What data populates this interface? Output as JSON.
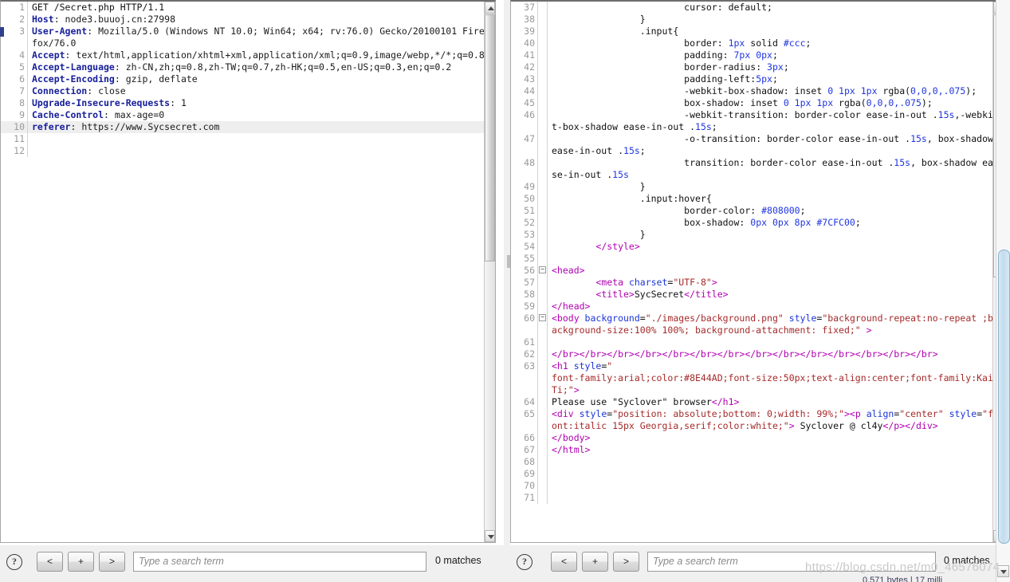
{
  "app": {
    "name": "burp-repeater-message-editor",
    "watermark": "https://blog.csdn.net/m0_46576074",
    "status_line": "0,571 bytes | 17 milli"
  },
  "colors": {
    "header_key": "#18209a",
    "tag": "#b000b0",
    "attribute": "#1c34d6",
    "attribute_value": "#a52a2a",
    "css_value": "#1f35e0",
    "gutter_text": "#999999",
    "highlight_row": "#eeeeee",
    "outer_scroll_thumb": "#c3dcee"
  },
  "left_pane": {
    "name": "request-pane",
    "first_line_number": 1,
    "highlighted_line": 10,
    "lines": [
      {
        "n": 1,
        "segments": [
          {
            "t": "GET /Secret.php HTTP/1.1",
            "c": "txt"
          }
        ]
      },
      {
        "n": 2,
        "segments": [
          {
            "t": "Host",
            "c": "hk"
          },
          {
            "t": ": node3.buuoj.cn:27998",
            "c": "hv"
          }
        ]
      },
      {
        "n": 3,
        "segments": [
          {
            "t": "User-Agent",
            "c": "hk"
          },
          {
            "t": ": Mozilla/5.0 (Windows NT 10.0; Win64; x64; rv:76.0) Gecko/20100101 Firefox/76.0",
            "c": "hv"
          }
        ]
      },
      {
        "n": 4,
        "segments": [
          {
            "t": "Accept",
            "c": "hk"
          },
          {
            "t": ": text/html,application/xhtml+xml,application/xml;q=0.9,image/webp,*/*;q=0.8",
            "c": "hv"
          }
        ]
      },
      {
        "n": 5,
        "segments": [
          {
            "t": "Accept-Language",
            "c": "hk"
          },
          {
            "t": ": zh-CN,zh;q=0.8,zh-TW;q=0.7,zh-HK;q=0.5,en-US;q=0.3,en;q=0.2",
            "c": "hv"
          }
        ]
      },
      {
        "n": 6,
        "segments": [
          {
            "t": "Accept-Encoding",
            "c": "hk"
          },
          {
            "t": ": gzip, deflate",
            "c": "hv"
          }
        ]
      },
      {
        "n": 7,
        "segments": [
          {
            "t": "Connection",
            "c": "hk"
          },
          {
            "t": ": close",
            "c": "hv"
          }
        ]
      },
      {
        "n": 8,
        "segments": [
          {
            "t": "Upgrade-Insecure-Requests",
            "c": "hk"
          },
          {
            "t": ": 1",
            "c": "hv"
          }
        ]
      },
      {
        "n": 9,
        "segments": [
          {
            "t": "Cache-Control",
            "c": "hk"
          },
          {
            "t": ": max-age=0",
            "c": "hv"
          }
        ]
      },
      {
        "n": 10,
        "segments": [
          {
            "t": "referer",
            "c": "hk"
          },
          {
            "t": ": https://www.Sycsecret.com",
            "c": "hv"
          }
        ],
        "hl": true
      },
      {
        "n": 11,
        "segments": []
      },
      {
        "n": 12,
        "segments": []
      }
    ],
    "toolbar": {
      "help_label": "?",
      "prev_label": "<",
      "add_label": "+",
      "next_label": ">",
      "search_placeholder": "Type a search term",
      "search_value": "",
      "matches_label": "0 matches"
    }
  },
  "right_pane": {
    "name": "response-pane",
    "first_line_number": 37,
    "fold_lines": [
      56,
      60
    ],
    "lines": [
      {
        "n": 37,
        "segments": [
          {
            "t": "                        ",
            "c": "txt"
          },
          {
            "t": "cursor",
            "c": "cssp"
          },
          {
            "t": ": ",
            "c": "punct"
          },
          {
            "t": "default",
            "c": "cssp"
          },
          {
            "t": ";",
            "c": "punct"
          }
        ]
      },
      {
        "n": 38,
        "segments": [
          {
            "t": "                }",
            "c": "txt"
          }
        ]
      },
      {
        "n": 39,
        "segments": [
          {
            "t": "                .input{",
            "c": "txt"
          }
        ]
      },
      {
        "n": 40,
        "segments": [
          {
            "t": "                        ",
            "c": "txt"
          },
          {
            "t": "border",
            "c": "cssp"
          },
          {
            "t": ": ",
            "c": "punct"
          },
          {
            "t": "1px",
            "c": "cssv"
          },
          {
            "t": " solid ",
            "c": "cssp"
          },
          {
            "t": "#ccc",
            "c": "cssv"
          },
          {
            "t": ";",
            "c": "punct"
          }
        ]
      },
      {
        "n": 41,
        "segments": [
          {
            "t": "                        ",
            "c": "txt"
          },
          {
            "t": "padding",
            "c": "cssp"
          },
          {
            "t": ": ",
            "c": "punct"
          },
          {
            "t": "7px 0px",
            "c": "cssv"
          },
          {
            "t": ";",
            "c": "punct"
          }
        ]
      },
      {
        "n": 42,
        "segments": [
          {
            "t": "                        ",
            "c": "txt"
          },
          {
            "t": "border-radius",
            "c": "cssp"
          },
          {
            "t": ": ",
            "c": "punct"
          },
          {
            "t": "3px",
            "c": "cssv"
          },
          {
            "t": ";",
            "c": "punct"
          }
        ]
      },
      {
        "n": 43,
        "segments": [
          {
            "t": "                        ",
            "c": "txt"
          },
          {
            "t": "padding-left",
            "c": "cssp"
          },
          {
            "t": ":",
            "c": "punct"
          },
          {
            "t": "5px",
            "c": "cssv"
          },
          {
            "t": ";",
            "c": "punct"
          }
        ]
      },
      {
        "n": 44,
        "segments": [
          {
            "t": "                        ",
            "c": "txt"
          },
          {
            "t": "-webkit-box-shadow",
            "c": "cssp"
          },
          {
            "t": ": inset ",
            "c": "punct"
          },
          {
            "t": "0 1px 1px",
            "c": "cssv"
          },
          {
            "t": " rgba(",
            "c": "cssp"
          },
          {
            "t": "0,0,0,.075",
            "c": "cssv"
          },
          {
            "t": ");",
            "c": "punct"
          }
        ]
      },
      {
        "n": 45,
        "segments": [
          {
            "t": "                        ",
            "c": "txt"
          },
          {
            "t": "box-shadow",
            "c": "cssp"
          },
          {
            "t": ": inset ",
            "c": "punct"
          },
          {
            "t": "0 1px 1px",
            "c": "cssv"
          },
          {
            "t": " rgba(",
            "c": "cssp"
          },
          {
            "t": "0,0,0,.075",
            "c": "cssv"
          },
          {
            "t": ");",
            "c": "punct"
          }
        ]
      },
      {
        "n": 46,
        "segments": [
          {
            "t": "                        ",
            "c": "txt"
          },
          {
            "t": "-webkit-transition",
            "c": "cssp"
          },
          {
            "t": ": border-color ease-in-out .",
            "c": "punct"
          },
          {
            "t": "15s",
            "c": "cssv"
          },
          {
            "t": ",-webkit-box-shadow ease-in-out .",
            "c": "punct"
          },
          {
            "t": "15s",
            "c": "cssv"
          },
          {
            "t": ";",
            "c": "punct"
          }
        ]
      },
      {
        "n": 47,
        "segments": [
          {
            "t": "                        ",
            "c": "txt"
          },
          {
            "t": "-o-transition",
            "c": "cssp"
          },
          {
            "t": ": border-color ease-in-out .",
            "c": "punct"
          },
          {
            "t": "15s",
            "c": "cssv"
          },
          {
            "t": ", box-shadow ease-in-out .",
            "c": "punct"
          },
          {
            "t": "15s",
            "c": "cssv"
          },
          {
            "t": ";",
            "c": "punct"
          }
        ]
      },
      {
        "n": 48,
        "segments": [
          {
            "t": "                        ",
            "c": "txt"
          },
          {
            "t": "transition",
            "c": "cssp"
          },
          {
            "t": ": border-color ease-in-out .",
            "c": "punct"
          },
          {
            "t": "15s",
            "c": "cssv"
          },
          {
            "t": ", box-shadow ease-in-out .",
            "c": "punct"
          },
          {
            "t": "15s",
            "c": "cssv"
          }
        ]
      },
      {
        "n": 49,
        "segments": [
          {
            "t": "                }",
            "c": "txt"
          }
        ]
      },
      {
        "n": 50,
        "segments": [
          {
            "t": "                .input:hover{",
            "c": "txt"
          }
        ]
      },
      {
        "n": 51,
        "segments": [
          {
            "t": "                        ",
            "c": "txt"
          },
          {
            "t": "border-color",
            "c": "cssp"
          },
          {
            "t": ": ",
            "c": "punct"
          },
          {
            "t": "#808000",
            "c": "cssv"
          },
          {
            "t": ";",
            "c": "punct"
          }
        ]
      },
      {
        "n": 52,
        "segments": [
          {
            "t": "                        ",
            "c": "txt"
          },
          {
            "t": "box-shadow",
            "c": "cssp"
          },
          {
            "t": ": ",
            "c": "punct"
          },
          {
            "t": "0px 0px 8px #7CFC00",
            "c": "cssv"
          },
          {
            "t": ";",
            "c": "punct"
          }
        ]
      },
      {
        "n": 53,
        "segments": [
          {
            "t": "                }",
            "c": "txt"
          }
        ]
      },
      {
        "n": 54,
        "segments": [
          {
            "t": "        ",
            "c": "txt"
          },
          {
            "t": "</style>",
            "c": "tag"
          }
        ]
      },
      {
        "n": 55,
        "segments": []
      },
      {
        "n": 56,
        "fold": true,
        "segments": [
          {
            "t": "<head>",
            "c": "tag"
          }
        ]
      },
      {
        "n": 57,
        "segments": [
          {
            "t": "        ",
            "c": "txt"
          },
          {
            "t": "<meta ",
            "c": "tag"
          },
          {
            "t": "charset",
            "c": "attr"
          },
          {
            "t": "=",
            "c": "txt"
          },
          {
            "t": "\"UTF-8\"",
            "c": "val"
          },
          {
            "t": ">",
            "c": "tag"
          }
        ]
      },
      {
        "n": 58,
        "segments": [
          {
            "t": "        ",
            "c": "txt"
          },
          {
            "t": "<title>",
            "c": "tag"
          },
          {
            "t": "SycSecret",
            "c": "txt"
          },
          {
            "t": "</title>",
            "c": "tag"
          }
        ]
      },
      {
        "n": 59,
        "segments": [
          {
            "t": "</head>",
            "c": "tag"
          }
        ]
      },
      {
        "n": 60,
        "fold": true,
        "segments": [
          {
            "t": "<body ",
            "c": "tag"
          },
          {
            "t": "background",
            "c": "attr"
          },
          {
            "t": "=",
            "c": "txt"
          },
          {
            "t": "\"./images/background.png\"",
            "c": "val"
          },
          {
            "t": " ",
            "c": "txt"
          },
          {
            "t": "style",
            "c": "attr"
          },
          {
            "t": "=",
            "c": "txt"
          },
          {
            "t": "\"background-repeat:no-repeat ;background-size:100% 100%; background-attachment: fixed;\"",
            "c": "val"
          },
          {
            "t": " >",
            "c": "tag"
          }
        ]
      },
      {
        "n": 61,
        "segments": []
      },
      {
        "n": 62,
        "segments": [
          {
            "t": "</br></br></br></br></br></br></br></br></br></br></br></br></br></br>",
            "c": "tag"
          }
        ]
      },
      {
        "n": 63,
        "segments": [
          {
            "t": "<h1 ",
            "c": "tag"
          },
          {
            "t": "style",
            "c": "attr"
          },
          {
            "t": "=",
            "c": "txt"
          },
          {
            "t": "\"\nfont-family:arial;color:#8E44AD;font-size:50px;text-align:center;font-family:KaiTi;\"",
            "c": "val"
          },
          {
            "t": ">",
            "c": "tag"
          }
        ]
      },
      {
        "n": 64,
        "segments": [
          {
            "t": "Please use \"Syclover\" browser",
            "c": "txt"
          },
          {
            "t": "</h1>",
            "c": "tag"
          }
        ]
      },
      {
        "n": 65,
        "segments": [
          {
            "t": "<div ",
            "c": "tag"
          },
          {
            "t": "style",
            "c": "attr"
          },
          {
            "t": "=",
            "c": "txt"
          },
          {
            "t": "\"position: absolute;bottom: 0;width: 99%;\"",
            "c": "val"
          },
          {
            "t": ">",
            "c": "tag"
          },
          {
            "t": "<p ",
            "c": "tag"
          },
          {
            "t": "align",
            "c": "attr"
          },
          {
            "t": "=",
            "c": "txt"
          },
          {
            "t": "\"center\"",
            "c": "val"
          },
          {
            "t": " ",
            "c": "txt"
          },
          {
            "t": "style",
            "c": "attr"
          },
          {
            "t": "=",
            "c": "txt"
          },
          {
            "t": "\"font:italic 15px Georgia,serif;color:white;\"",
            "c": "val"
          },
          {
            "t": ">",
            "c": "tag"
          },
          {
            "t": " Syclover @ cl4y",
            "c": "txt"
          },
          {
            "t": "</p></div>",
            "c": "tag"
          }
        ]
      },
      {
        "n": 66,
        "segments": [
          {
            "t": "</body>",
            "c": "tag"
          }
        ]
      },
      {
        "n": 67,
        "segments": [
          {
            "t": "</html>",
            "c": "tag"
          }
        ]
      },
      {
        "n": 68,
        "segments": []
      },
      {
        "n": 69,
        "segments": []
      },
      {
        "n": 70,
        "segments": []
      },
      {
        "n": 71,
        "segments": []
      }
    ],
    "toolbar": {
      "help_label": "?",
      "prev_label": "<",
      "add_label": "+",
      "next_label": ">",
      "search_placeholder": "Type a search term",
      "search_value": "",
      "matches_label": "0 matches"
    }
  }
}
